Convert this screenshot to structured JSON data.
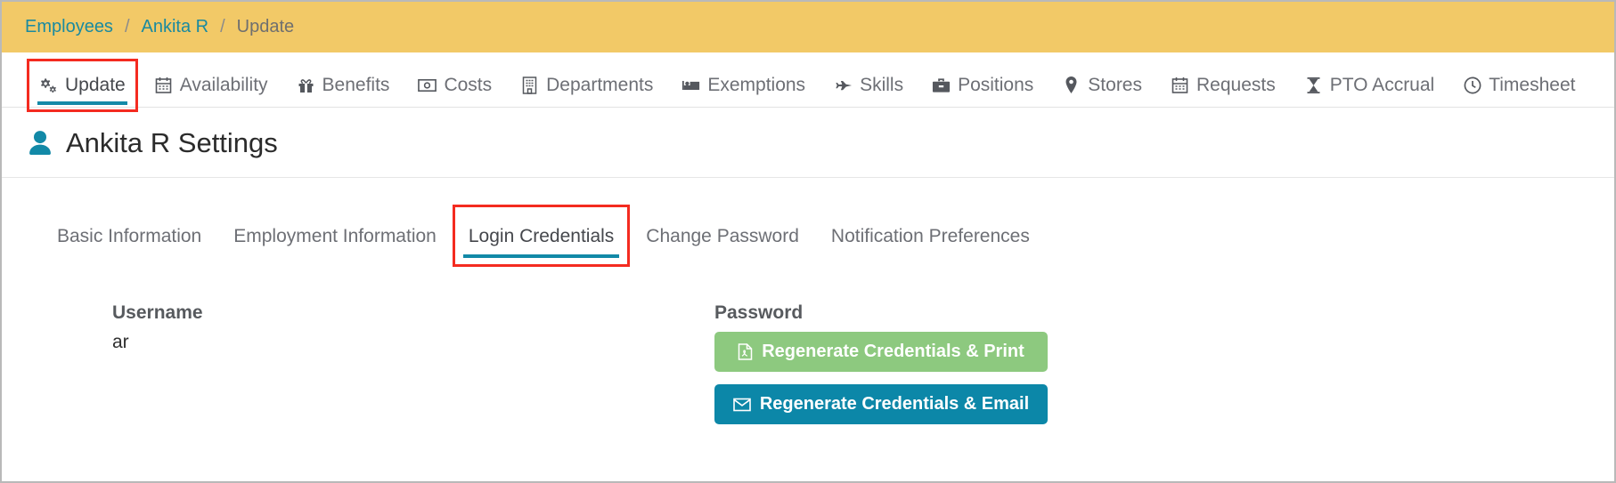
{
  "colors": {
    "breadcrumb_bg": "#f2c967",
    "link_teal": "#1a8aa0",
    "accent_teal": "#1289a7",
    "highlight_red": "#f42b20",
    "button_green": "#8dc97f",
    "button_teal": "#0c87a8"
  },
  "breadcrumb": {
    "items": [
      {
        "label": "Employees",
        "link": true
      },
      {
        "label": "Ankita R",
        "link": true
      },
      {
        "label": "Update",
        "link": false
      }
    ],
    "separator": "/"
  },
  "primary_tabs": [
    {
      "label": "Update",
      "icon": "gears-icon",
      "active": true,
      "highlighted": true
    },
    {
      "label": "Availability",
      "icon": "calendar-icon",
      "active": false,
      "highlighted": false
    },
    {
      "label": "Benefits",
      "icon": "gift-icon",
      "active": false,
      "highlighted": false
    },
    {
      "label": "Costs",
      "icon": "money-bill-icon",
      "active": false,
      "highlighted": false
    },
    {
      "label": "Departments",
      "icon": "building-icon",
      "active": false,
      "highlighted": false
    },
    {
      "label": "Exemptions",
      "icon": "bed-icon",
      "active": false,
      "highlighted": false
    },
    {
      "label": "Skills",
      "icon": "fighter-jet-icon",
      "active": false,
      "highlighted": false
    },
    {
      "label": "Positions",
      "icon": "briefcase-icon",
      "active": false,
      "highlighted": false
    },
    {
      "label": "Stores",
      "icon": "map-marker-icon",
      "active": false,
      "highlighted": false
    },
    {
      "label": "Requests",
      "icon": "calendar-icon",
      "active": false,
      "highlighted": false
    },
    {
      "label": "PTO Accrual",
      "icon": "hourglass-icon",
      "active": false,
      "highlighted": false
    },
    {
      "label": "Timesheet",
      "icon": "clock-icon",
      "active": false,
      "highlighted": false
    }
  ],
  "page": {
    "title": "Ankita R Settings",
    "title_icon": "user-icon"
  },
  "sub_tabs": [
    {
      "label": "Basic Information",
      "active": false,
      "highlighted": false
    },
    {
      "label": "Employment Information",
      "active": false,
      "highlighted": false
    },
    {
      "label": "Login Credentials",
      "active": true,
      "highlighted": true
    },
    {
      "label": "Change Password",
      "active": false,
      "highlighted": false
    },
    {
      "label": "Notification Preferences",
      "active": false,
      "highlighted": false
    }
  ],
  "form": {
    "username": {
      "label": "Username",
      "value": "ar"
    },
    "password": {
      "label": "Password",
      "print_button": {
        "label": "Regenerate Credentials & Print",
        "icon": "file-pdf-icon"
      },
      "email_button": {
        "label": "Regenerate Credentials & Email",
        "icon": "envelope-icon"
      }
    }
  }
}
